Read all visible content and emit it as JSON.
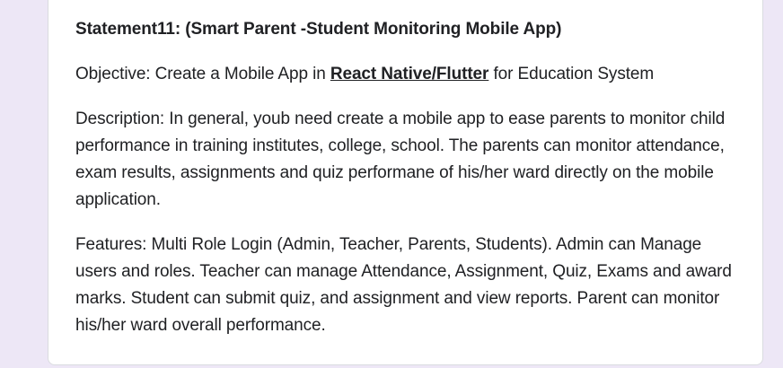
{
  "card": {
    "title": "Statement11: (Smart  Parent -Student Monitoring Mobile App)",
    "objective": {
      "prefix": "Objective: Create a Mobile App in ",
      "link_text": "React Native/Flutter",
      "suffix": " for Education System"
    },
    "description": "Description: In general, youb need create a mobile app to ease parents to monitor child performance in  training institutes, college, school. The parents can monitor attendance, exam results, assignments and quiz performane of his/her ward directly on the mobile application.",
    "features": "Features: Multi Role Login (Admin, Teacher, Parents, Students). Admin can Manage users and roles. Teacher can manage Attendance, Assignment, Quiz, Exams and award marks. Student can submit quiz, and assignment and view reports. Parent can monitor his/her ward overall performance."
  }
}
